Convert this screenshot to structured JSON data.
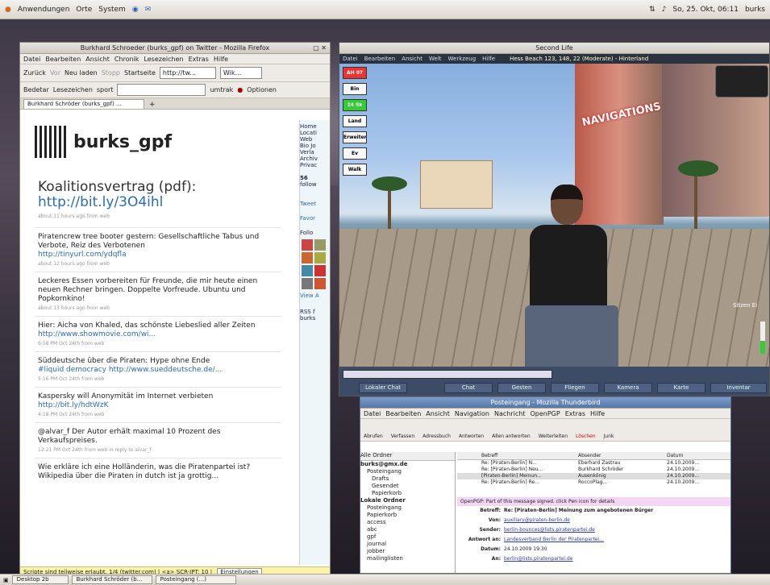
{
  "desktop": {
    "topbar": {
      "menu_apps": "Anwendungen",
      "menu_places": "Orte",
      "menu_system": "System",
      "clock": "So, 25. Okt, 06:11",
      "user": "burks"
    },
    "taskbar": {
      "items": [
        "Desktop 2b",
        "Burkhard Schröder (b...",
        "Posteingang (...)"
      ]
    }
  },
  "firefox": {
    "title": "Burkhard Schroeder (burks_gpf) on Twitter - Mozilla Firefox",
    "menu": [
      "Datei",
      "Bearbeiten",
      "Ansicht",
      "Chronik",
      "Lesezeichen",
      "Extras",
      "Hilfe"
    ],
    "nav": {
      "back": "Zurück",
      "forward": "Vor",
      "reload": "Neu laden",
      "stop": "Stopp",
      "home": "Startseite",
      "url": "http://tw...",
      "search": "Wik..."
    },
    "bookmarks": {
      "delete": "Bedetar",
      "bookmark": "Lesezeichen",
      "label": "sport",
      "right1": "umtrak",
      "right2": "Optionen"
    },
    "tab": "Burkhard Schröder (burks_gpf) ...",
    "profile": {
      "handle": "burks_gpf",
      "headline": "Koalitionsvertrag (pdf):",
      "headline_link": "http://bit.ly/3O4ihl",
      "headline_meta": "about 11 hours ago from web"
    },
    "tweets": [
      {
        "text": "Piratencrew tree booter gestern: Gesellschaftliche Tabus und Verbote, Reiz des Verbotenen",
        "link": "http://tinyurl.com/ydqfla",
        "meta": "about 12 hours ago from web"
      },
      {
        "text": "Leckeres Essen vorbereiten für Freunde, die mir heute einen neuen Rechner bringen. Doppelte Vorfreude. Ubuntu und Popkornkino!",
        "link": "",
        "meta": "about 13 hours ago from web"
      },
      {
        "text": "Hier: Aicha von Khaled, das schönste Liebeslied aller Zeiten",
        "link": "http://www.showmovie.com/wi...",
        "meta": "6:58 PM Oct 24th from web"
      },
      {
        "text": "Süddeutsche über die Piraten: Hype ohne Ende",
        "link": "#liquid democracy http://www.sueddeutsche.de/...",
        "meta": "5:16 PM Oct 24th from web"
      },
      {
        "text": "Kaspersky will Anonymität im Internet verbieten",
        "link": "http://bit.ly/hdtWzK",
        "meta": "4:18 PM Oct 24th from web"
      },
      {
        "text": "@alvar_f Der Autor erhält maximal 10 Prozent des Verkaufspreises.",
        "link": "",
        "meta": "12:21 PM Oct 24th from web in reply to alvar_f"
      },
      {
        "text": "Wie erkläre ich eine Holländerin, was die Piratenpartei ist? Wikipedia über die Piraten in dutch ist ja grottig...",
        "link": "",
        "meta": ""
      }
    ],
    "sidebar": [
      "Home",
      "Locati",
      "Web",
      "Bio Jo",
      "Verla",
      "Archiv",
      "Privac",
      "56",
      "follow",
      "Tweet",
      "Favor",
      "Follo",
      "View A",
      "RSS f",
      "burks"
    ],
    "status": "Scripte sind teilweise erlaubt, 1/4 (twitter.com) | <a> SCR-IPT: 10 |",
    "status_button": "Einstellungen"
  },
  "secondlife": {
    "title": "Second Life",
    "menu": [
      "Datei",
      "Bearbeiten",
      "Ansicht",
      "Welt",
      "Werkzeug",
      "Hilfe"
    ],
    "location": "Hess Beach 123, 148, 22 (Moderate) - Hinterland",
    "buttons": [
      "AH 07",
      "Bin",
      "24 Sk",
      "Land",
      "Erweiter",
      "Ev",
      "Walk"
    ],
    "sign": "NAVIGATIONS",
    "bottom_tabs": [
      "Chat",
      "Gesten",
      "Fliegen",
      "Kamera",
      "Karte",
      "Inventar"
    ],
    "bottom_chat": "Lokaler Chat",
    "right_label": "Sitzen Ei"
  },
  "thunderbird": {
    "title": "Posteingang - Mozilla Thunderbird",
    "menu": [
      "Datei",
      "Bearbeiten",
      "Ansicht",
      "Navigation",
      "Nachricht",
      "OpenPGP",
      "Extras",
      "Hilfe"
    ],
    "toolbar": [
      "Abrufen",
      "Verfassen",
      "Adressbuch",
      "Antworten",
      "Allen antworten",
      "Weiterleiten",
      "Löschen",
      "Junk"
    ],
    "folders_header": "Alle Ordner",
    "folders": [
      "burks@gmx.de",
      "Posteingang",
      "Drafts",
      "Gesendet",
      "Papierkorb",
      "Lokale Ordner",
      "Posteingang",
      "Papierkorb",
      "access",
      "abc",
      "gpf",
      "journal",
      "jobber",
      "mailinglisten"
    ],
    "columns": [
      "Betreff",
      "Absender",
      "Datum"
    ],
    "messages": [
      {
        "subject": "Re: [Piraten-Berlin] N...",
        "from": "Eberhard Zastrau",
        "date": "24.10.2009..."
      },
      {
        "subject": "Re: [Piraten-Berlin] Neu...",
        "from": "Burkhard Schröder",
        "date": "24.10.2009..."
      },
      {
        "subject": "[Piraten-Berlin] Meinun...",
        "from": "Ausenkönig",
        "date": "24.10.2009..."
      },
      {
        "subject": "Re: [Piraten-Berlin] Re...",
        "from": "RoccoPlag...",
        "date": "24.10.2009..."
      }
    ],
    "pgp": "OpenPGP: Part of this message signed. click Pen icon for details",
    "header": {
      "subject_label": "Betreff:",
      "subject": "Re: [Piraten-Berlin] Meinung zum angebotenen Bürger",
      "from_label": "Von:",
      "from": "auxiliary@piraten-berlin.de",
      "sender_label": "Sender:",
      "sender": "berlin-bounces@lists.piratenpartei.de",
      "reply_label": "Antwort an:",
      "reply": "Landesverband Berlin der Piratenpartei...",
      "date_label": "Datum:",
      "date": "24.10.2009 19:30",
      "to_label": "An:",
      "to": "berlin@lists.piratenpartei.de"
    }
  }
}
